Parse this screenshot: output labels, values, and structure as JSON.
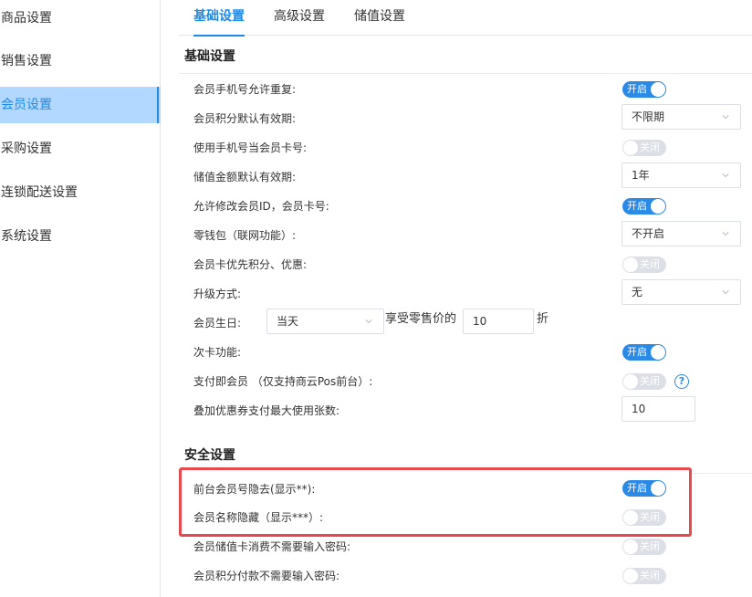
{
  "sidebar": {
    "items": [
      {
        "label": "商品设置"
      },
      {
        "label": "销售设置"
      },
      {
        "label": "会员设置"
      },
      {
        "label": "采购设置"
      },
      {
        "label": "连锁配送设置"
      },
      {
        "label": "系统设置"
      }
    ],
    "active_index": 2
  },
  "tabs": [
    {
      "label": "基础设置"
    },
    {
      "label": "高级设置"
    },
    {
      "label": "储值设置"
    }
  ],
  "basic": {
    "title": "基础设置",
    "phone_repeat": {
      "label": "会员手机号允许重复:",
      "switch": "开启"
    },
    "points_validity": {
      "label": "会员积分默认有效期:",
      "value": "不限期"
    },
    "phone_as_card": {
      "label": "使用手机号当会员卡号:",
      "switch": "关闭"
    },
    "stored_validity": {
      "label": "储值金额默认有效期:",
      "value": "1年"
    },
    "modify_id": {
      "label": "允许修改会员ID，会员卡号:",
      "switch": "开启"
    },
    "wallet": {
      "label": "零钱包（联网功能）:",
      "value": "不开启"
    },
    "card_priority": {
      "label": "会员卡优先积分、优惠:",
      "switch": "关闭"
    },
    "upgrade": {
      "label": "升级方式:",
      "value": "无"
    },
    "birthday": {
      "label": "会员生日:",
      "value": "当天",
      "text_before": "享受零售价的",
      "discount": "10",
      "text_after": "折"
    },
    "count_card": {
      "label": "次卡功能:",
      "switch": "开启"
    },
    "pay_member": {
      "label": "支付即会员 （仅支持商云Pos前台）:",
      "switch": "关闭",
      "help": "?"
    },
    "coupon_max": {
      "label": "叠加优惠券支付最大使用张数:",
      "value": "10"
    }
  },
  "security": {
    "title": "安全设置",
    "hide_number": {
      "label": "前台会员号隐去(显示**):",
      "switch": "开启"
    },
    "hide_name": {
      "label": "会员名称隐藏（显示***）:",
      "switch": "关闭"
    },
    "stored_no_pwd": {
      "label": "会员储值卡消费不需要输入密码:",
      "switch": "关闭"
    },
    "points_no_pwd": {
      "label": "会员积分付款不需要输入密码:",
      "switch": "关闭"
    }
  },
  "colors": {
    "accent": "#2b8ae6",
    "switch_off": "#dcdfe6",
    "sidebar_active_bg": "#b3d8ff",
    "highlight": "#e8494e"
  }
}
